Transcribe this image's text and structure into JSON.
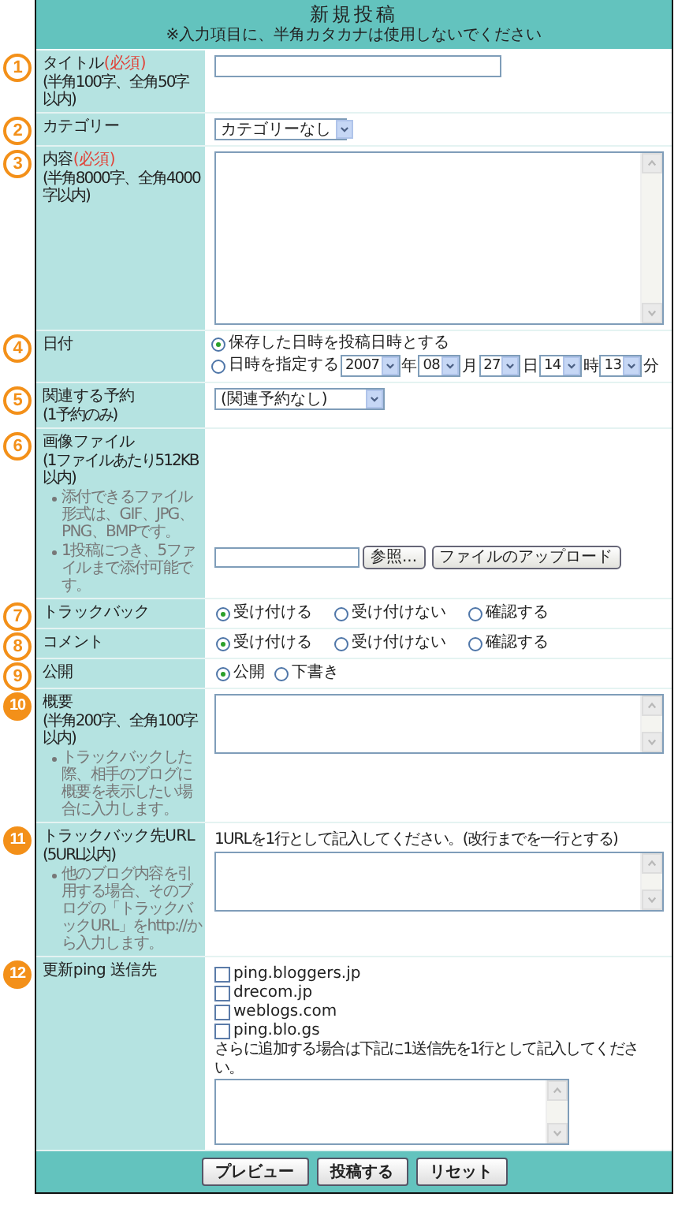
{
  "header": {
    "title": "新規投稿",
    "notice": "※入力項目に、半角カタカナは使用しないでください"
  },
  "rows": [
    {
      "number": "1",
      "label": "タイトル",
      "required": "(必須)",
      "note": "(半角100字、全角50字以内)",
      "kind": "text"
    },
    {
      "number": "2",
      "label": "カテゴリー",
      "kind": "select",
      "value": "カテゴリーなし"
    },
    {
      "number": "3",
      "label": "内容",
      "required": "(必須)",
      "note": "(半角8000字、全角4000字以内)",
      "kind": "editor"
    },
    {
      "number": "4",
      "label": "日付",
      "kind": "date",
      "options": [
        {
          "label": "保存した日時を投稿日時とする",
          "selected": true
        },
        {
          "label": "日時を指定する",
          "selected": false
        }
      ],
      "parts": [
        {
          "value": "2007",
          "unit": "年"
        },
        {
          "value": "08",
          "unit": "月"
        },
        {
          "value": "27",
          "unit": "日"
        },
        {
          "value": "14",
          "unit": "時"
        },
        {
          "value": "13",
          "unit": "分"
        }
      ]
    },
    {
      "number": "5",
      "label": "関連する予約",
      "note": "(1予約のみ)",
      "kind": "select",
      "value": "(関連予約なし)"
    },
    {
      "number": "6",
      "label": "画像ファイル",
      "note": "(1ファイルあたり512KB以内)",
      "bullets": [
        "添付できるファイル形式は、GIF、JPG、PNG、BMPです。",
        "1投稿につき、5ファイルまで添付可能です。"
      ],
      "kind": "file",
      "browse": "参照...",
      "upload": "ファイルのアップロード"
    },
    {
      "number": "7",
      "label": "トラックバック",
      "kind": "radios",
      "options": [
        {
          "label": "受け付ける",
          "selected": true
        },
        {
          "label": "受け付けない",
          "selected": false
        },
        {
          "label": "確認する",
          "selected": false
        }
      ]
    },
    {
      "number": "8",
      "label": "コメント",
      "kind": "radios",
      "options": [
        {
          "label": "受け付ける",
          "selected": true
        },
        {
          "label": "受け付けない",
          "selected": false
        },
        {
          "label": "確認する",
          "selected": false
        }
      ]
    },
    {
      "number": "9",
      "label": "公開",
      "kind": "radios",
      "options": [
        {
          "label": "公開",
          "selected": true
        },
        {
          "label": "下書き",
          "selected": false
        }
      ]
    },
    {
      "number": "10",
      "label": "概要",
      "note": "(半角200字、全角100字以内)",
      "bullets": [
        "トラックバックした際、相手のブログに概要を表示したい場合に入力します。"
      ],
      "kind": "textarea"
    },
    {
      "number": "11",
      "label": "トラックバック先URL",
      "note": "(5URL以内)",
      "bullets": [
        "他のブログ内容を引用する場合、そのブログの「トラックバックURL」をhttp://から入力します。"
      ],
      "kind": "textarea",
      "hint": "1URLを1行として記入してください。(改行までを一行とする)"
    },
    {
      "number": "12",
      "label": "更新ping 送信先",
      "kind": "checklist",
      "items": [
        {
          "label": "ping.bloggers.jp",
          "checked": false
        },
        {
          "label": "drecom.jp",
          "checked": false
        },
        {
          "label": "weblogs.com",
          "checked": false
        },
        {
          "label": "ping.blo.gs",
          "checked": false
        }
      ],
      "hint": "さらに追加する場合は下記に1送信先を1行として記入してください。"
    }
  ],
  "buttons": [
    "プレビュー",
    "投稿する",
    "リセット"
  ]
}
